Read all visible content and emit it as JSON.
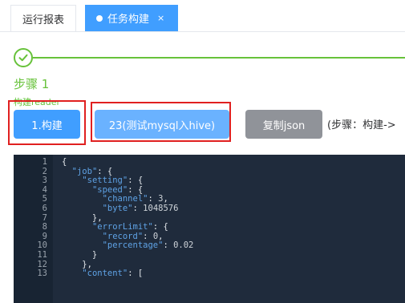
{
  "tabs": [
    {
      "label": "运行报表"
    },
    {
      "label": "任务构建",
      "close": "×"
    }
  ],
  "steps": {
    "title": "步骤 1",
    "desc": "构建reader"
  },
  "buttons": {
    "build": "1.构建",
    "job": "23(测试mysql入hive)",
    "copy": "复制json"
  },
  "hint": "(步骤：构建->",
  "editor": {
    "lines": [
      {
        "n": "1",
        "t": "{"
      },
      {
        "n": "2",
        "t": "  \"job\": {"
      },
      {
        "n": "3",
        "t": "    \"setting\": {"
      },
      {
        "n": "4",
        "t": "      \"speed\": {"
      },
      {
        "n": "5",
        "t": "        \"channel\": 3,"
      },
      {
        "n": "6",
        "t": "        \"byte\": 1048576"
      },
      {
        "n": "7",
        "t": "      },"
      },
      {
        "n": "8",
        "t": "      \"errorLimit\": {"
      },
      {
        "n": "9",
        "t": "        \"record\": 0,"
      },
      {
        "n": "10",
        "t": "        \"percentage\": 0.02"
      },
      {
        "n": "11",
        "t": "      }"
      },
      {
        "n": "12",
        "t": "    },"
      },
      {
        "n": "13",
        "t": "    \"content\": ["
      }
    ]
  },
  "colors": {
    "primary": "#409eff",
    "success": "#67c23a",
    "highlight": "#e02020",
    "editor_bg": "#1f2b3c"
  },
  "icons": [
    "check-icon",
    "close-icon"
  ]
}
